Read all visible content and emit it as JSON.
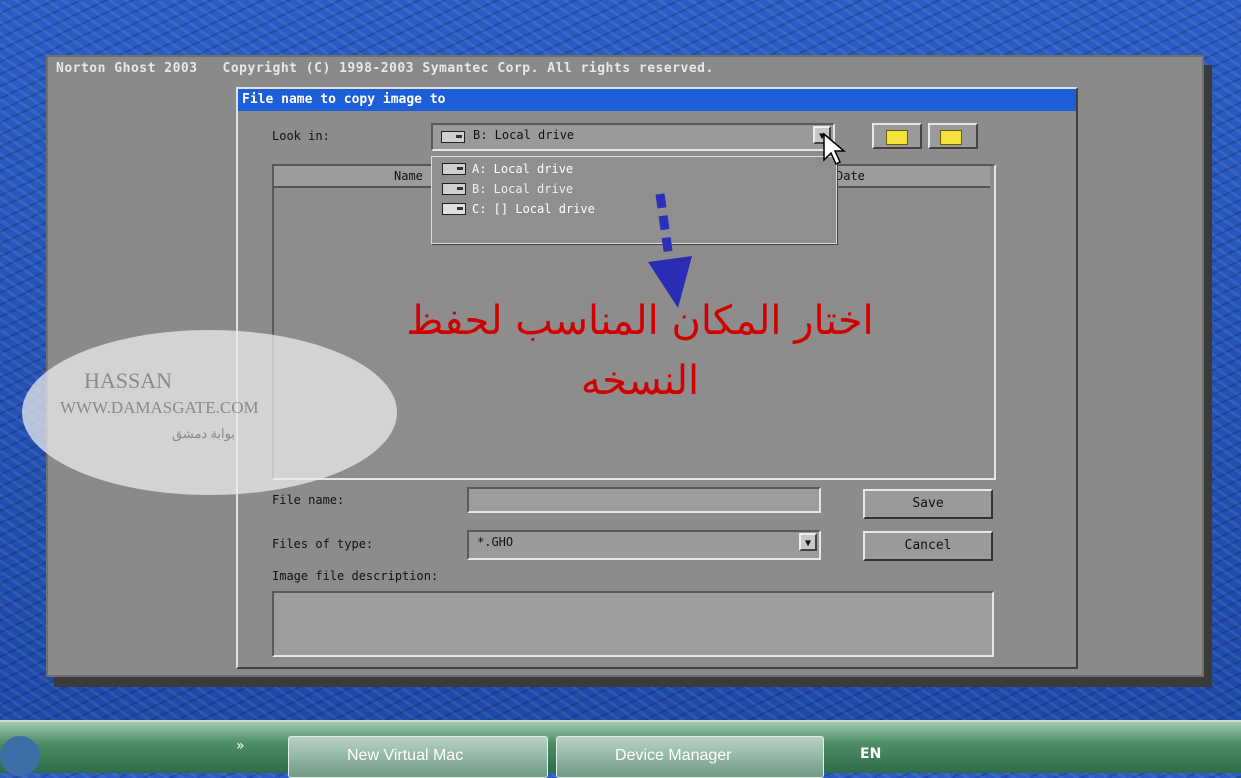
{
  "app": {
    "title": "Norton Ghost 2003   Copyright (C) 1998-2003 Symantec Corp. All rights reserved."
  },
  "dialog": {
    "title": "File name to copy image to",
    "look_in_label": "Look in:",
    "look_in_value": "B: Local drive",
    "drives": [
      "A: Local drive",
      "B: Local drive",
      "C: [] Local drive"
    ],
    "columns": {
      "name": "Name",
      "date": "Date"
    },
    "file_name_label": "File name:",
    "file_name_value": "",
    "files_of_type_label": "Files of type:",
    "files_of_type_value": "*.GHO",
    "description_label": "Image file description:",
    "description_value": "",
    "save_label": "Save",
    "cancel_label": "Cancel"
  },
  "annotation": {
    "line1": "اختار المكان المناسب لحفظ",
    "line2": "النسخه",
    "color": "#d10000"
  },
  "watermark": {
    "line1": "HASSAN",
    "line2": "WWW.DAMASGATE.COM",
    "line3": "بوابة دمشق"
  },
  "taskbar": {
    "items": [
      "New Virtual Mac",
      "Device Manager"
    ],
    "overflow": "»",
    "lang": "EN"
  }
}
